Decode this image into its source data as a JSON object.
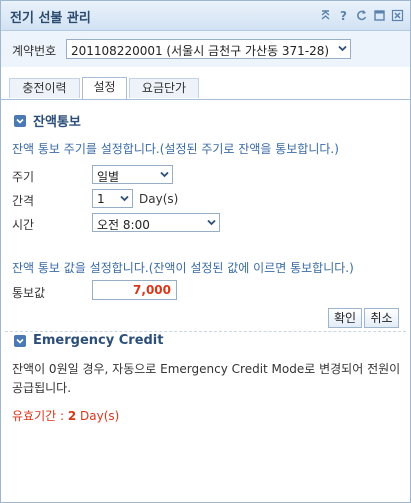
{
  "window": {
    "title": "전기 선불 관리",
    "icons": [
      "collapse-icon",
      "help-icon",
      "refresh-icon",
      "maximize-icon",
      "close-icon"
    ]
  },
  "contract": {
    "label": "계약번호",
    "selected": "201108220001 (서울시 금천구 가산동 371-28)"
  },
  "tabs": [
    {
      "label": "충전이력",
      "active": false
    },
    {
      "label": "설정",
      "active": true
    },
    {
      "label": "요금단가",
      "active": false
    }
  ],
  "balance_notice": {
    "title": "잔액통보",
    "cycle_info": "잔액 통보 주기를 설정합니다.(설정된 주기로 잔액을 통보합니다.)",
    "cycle_label": "주기",
    "cycle_value": "일별",
    "interval_label": "간격",
    "interval_value": "1",
    "interval_unit": "Day(s)",
    "time_label": "시간",
    "time_value": "오전 8:00",
    "amount_info": "잔액 통보 값을 설정합니다.(잔액이 설정된 값에 이르면 통보합니다.)",
    "amount_label": "통보값",
    "amount_value": "7,000",
    "confirm_label": "확인",
    "cancel_label": "취소"
  },
  "emergency": {
    "title": "Emergency Credit",
    "description": "잔액이 0원일 경우, 자동으로 Emergency Credit Mode로 변경되어 전원이 공급됩니다.",
    "validity_label": "유효기간 :",
    "validity_value": "2",
    "validity_unit": "Day(s)"
  },
  "colors": {
    "accent": "#2c4f7a",
    "info_text": "#3b6ba5",
    "highlight": "#d9361b",
    "titlebar": "#d2e2f3"
  }
}
